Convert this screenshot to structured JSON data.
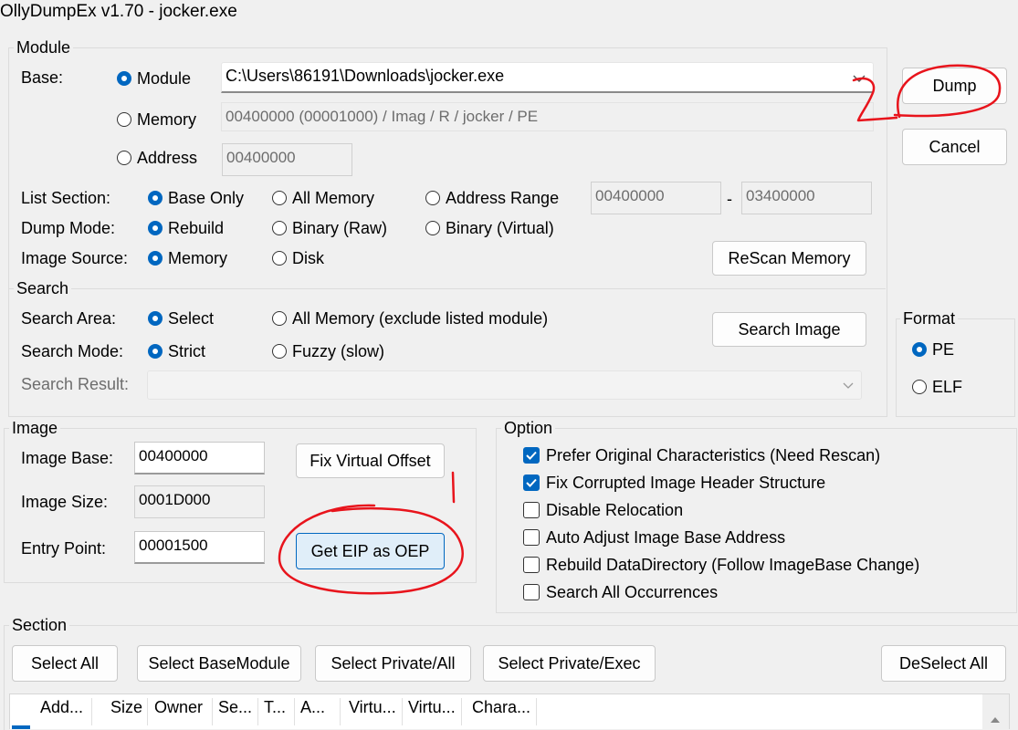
{
  "window": {
    "title": "OllyDumpEx v1.70 - jocker.exe"
  },
  "module_group": {
    "label": "Module",
    "base_label": "Base:",
    "radios": {
      "module": "Module",
      "memory": "Memory",
      "address": "Address"
    },
    "module_path": "C:\\Users\\86191\\Downloads\\jocker.exe",
    "memory_value": "00400000 (00001000) / Imag / R     / jocker / PE",
    "address_value": "00400000",
    "list_section": {
      "label": "List Section:",
      "options": [
        "Base Only",
        "All Memory",
        "Address Range"
      ],
      "selected": "Base Only",
      "range_start": "00400000",
      "range_dash": "-",
      "range_end": "03400000"
    },
    "dump_mode": {
      "label": "Dump Mode:",
      "options": [
        "Rebuild",
        "Binary (Raw)",
        "Binary (Virtual)"
      ],
      "selected": "Rebuild"
    },
    "image_source": {
      "label": "Image Source:",
      "options": [
        "Memory",
        "Disk"
      ],
      "selected": "Memory"
    },
    "rescan_label": "ReScan Memory"
  },
  "search_group": {
    "label": "Search",
    "area": {
      "label": "Search Area:",
      "options": [
        "Select",
        "All Memory (exclude listed module)"
      ],
      "selected": "Select"
    },
    "mode": {
      "label": "Search Mode:",
      "options": [
        "Strict",
        "Fuzzy (slow)"
      ],
      "selected": "Strict"
    },
    "result_label": "Search Result:",
    "result_value": "",
    "search_image_label": "Search Image"
  },
  "buttons": {
    "dump": "Dump",
    "cancel": "Cancel"
  },
  "format_group": {
    "label": "Format",
    "options": [
      "PE",
      "ELF"
    ],
    "selected": "PE"
  },
  "image_group": {
    "label": "Image",
    "image_base_label": "Image Base:",
    "image_base": "00400000",
    "image_size_label": "Image Size:",
    "image_size": "0001D000",
    "entry_point_label": "Entry Point:",
    "entry_point": "00001500",
    "fix_virtual_offset": "Fix Virtual Offset",
    "get_eip_as_oep": "Get EIP as OEP"
  },
  "option_group": {
    "label": "Option",
    "items": [
      {
        "label": "Prefer Original Characteristics (Need Rescan)",
        "checked": true
      },
      {
        "label": "Fix Corrupted Image Header Structure",
        "checked": true
      },
      {
        "label": "Disable Relocation",
        "checked": false
      },
      {
        "label": "Auto Adjust Image Base Address",
        "checked": false
      },
      {
        "label": "Rebuild DataDirectory (Follow ImageBase Change)",
        "checked": false
      },
      {
        "label": "Search All Occurrences",
        "checked": false
      }
    ]
  },
  "section_group": {
    "label": "Section",
    "buttons": [
      "Select All",
      "Select BaseModule",
      "Select Private/All",
      "Select Private/Exec",
      "DeSelect All"
    ],
    "columns": [
      "Add...",
      "Size",
      "Owner",
      "Se...",
      "T...",
      "A...",
      "Virtu...",
      "Virtu...",
      "Chara..."
    ]
  },
  "annotations": {
    "step1": "1",
    "step2": "2",
    "color": "#e8141c"
  },
  "colors": {
    "accent": "#0067c0",
    "window_bg": "#f0f0f0"
  }
}
